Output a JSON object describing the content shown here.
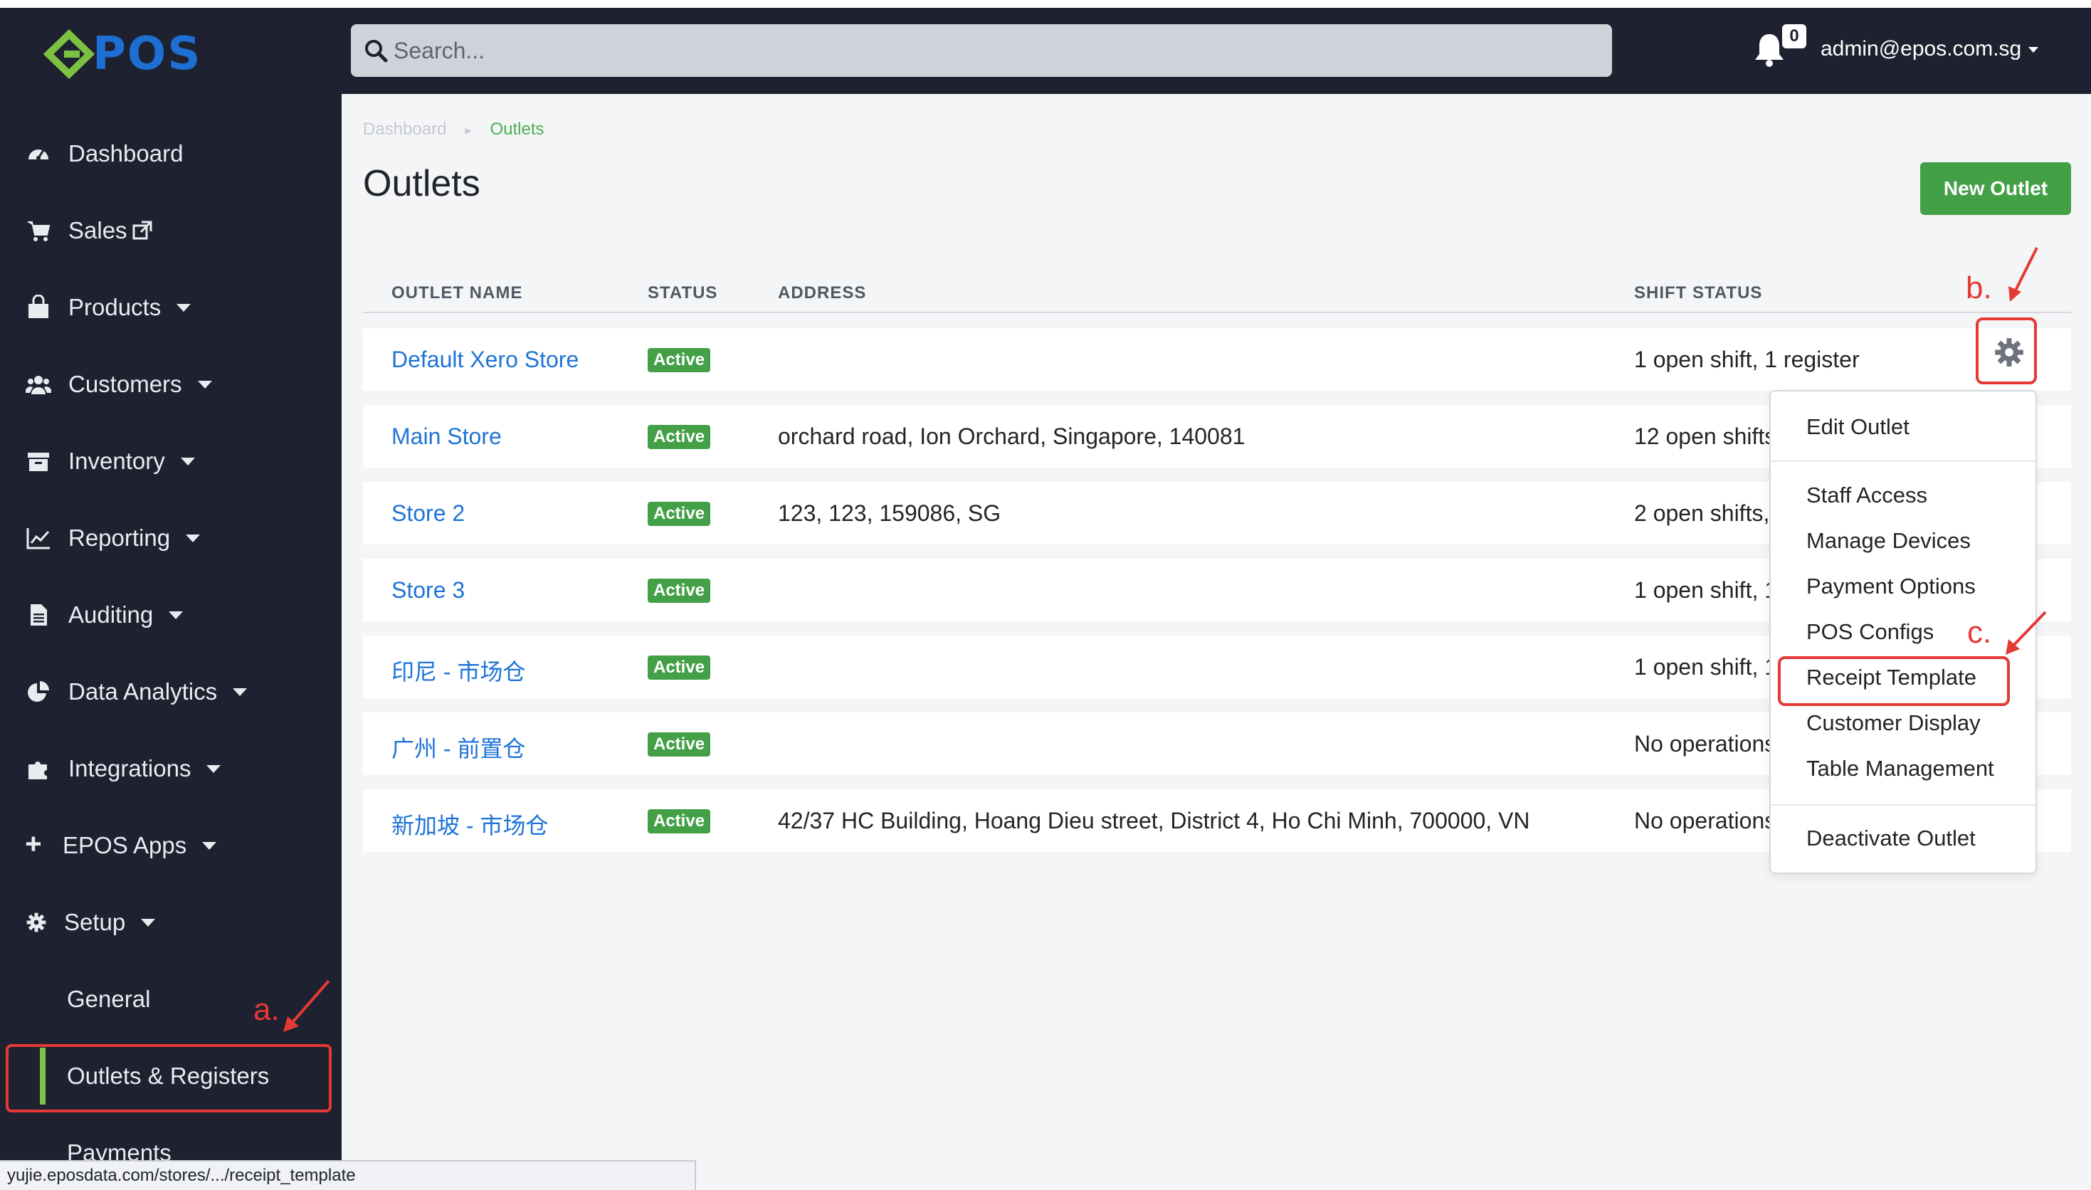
{
  "header": {
    "logo_text": "POS",
    "search_placeholder": "Search...",
    "notifications_count": "0",
    "user_email": "admin@epos.com.sg"
  },
  "sidebar": {
    "items": [
      {
        "label": "Dashboard",
        "icon": "palette-icon",
        "has_caret": false
      },
      {
        "label": "Sales",
        "icon": "cart-icon",
        "has_caret": false,
        "external": true
      },
      {
        "label": "Products",
        "icon": "bag-icon",
        "has_caret": true
      },
      {
        "label": "Customers",
        "icon": "users-icon",
        "has_caret": true
      },
      {
        "label": "Inventory",
        "icon": "archive-icon",
        "has_caret": true
      },
      {
        "label": "Reporting",
        "icon": "chart-line-icon",
        "has_caret": true
      },
      {
        "label": "Auditing",
        "icon": "file-icon",
        "has_caret": true
      },
      {
        "label": "Data Analytics",
        "icon": "pie-chart-icon",
        "has_caret": true
      },
      {
        "label": "Integrations",
        "icon": "puzzle-icon",
        "has_caret": true
      },
      {
        "label": "EPOS Apps",
        "icon": "plus-icon",
        "has_caret": true
      },
      {
        "label": "Setup",
        "icon": "gear-icon",
        "has_caret": true
      }
    ],
    "sub_items": [
      {
        "label": "General",
        "active": false
      },
      {
        "label": "Outlets & Registers",
        "active": true
      },
      {
        "label": "Payments",
        "active": false
      }
    ]
  },
  "breadcrumb": {
    "items": [
      "Dashboard",
      "Outlets"
    ]
  },
  "page": {
    "title": "Outlets",
    "new_button": "New Outlet"
  },
  "table": {
    "columns": [
      "OUTLET NAME",
      "STATUS",
      "ADDRESS",
      "SHIFT STATUS"
    ],
    "rows": [
      {
        "name": "Default Xero Store",
        "status": "Active",
        "address": "",
        "shift": "1 open shift, 1 register"
      },
      {
        "name": "Main Store",
        "status": "Active",
        "address": "orchard road, Ion Orchard, Singapore, 140081",
        "shift": "12 open shifts"
      },
      {
        "name": "Store 2",
        "status": "Active",
        "address": "123, 123, 159086, SG",
        "shift": "2 open shifts,"
      },
      {
        "name": "Store 3",
        "status": "Active",
        "address": "",
        "shift": "1 open shift, 1"
      },
      {
        "name": "印尼 - 市场仓",
        "status": "Active",
        "address": "",
        "shift": "1 open shift, 1"
      },
      {
        "name": "广州 - 前置仓",
        "status": "Active",
        "address": "",
        "shift": "No operations"
      },
      {
        "name": "新加坡 - 市场仓",
        "status": "Active",
        "address": "42/37 HC Building, Hoang Dieu street, District 4, Ho Chi Minh, 700000, VN",
        "shift": "No operations"
      }
    ]
  },
  "dropdown": {
    "items": [
      "Edit Outlet",
      "Staff Access",
      "Manage Devices",
      "Payment Options",
      "POS Configs",
      "Receipt Template",
      "Customer Display",
      "Table Management",
      "Deactivate Outlet"
    ]
  },
  "annotations": {
    "a": "a.",
    "b": "b.",
    "c": "c."
  },
  "statusbar": {
    "url": "yujie.eposdata.com/stores/.../receipt_template"
  },
  "colors": {
    "sidebar_bg": "#1e2130",
    "accent_green": "#43a047",
    "link_blue": "#1f74d6",
    "annotation_red": "#e53935",
    "active_indicator": "#7cc242"
  }
}
